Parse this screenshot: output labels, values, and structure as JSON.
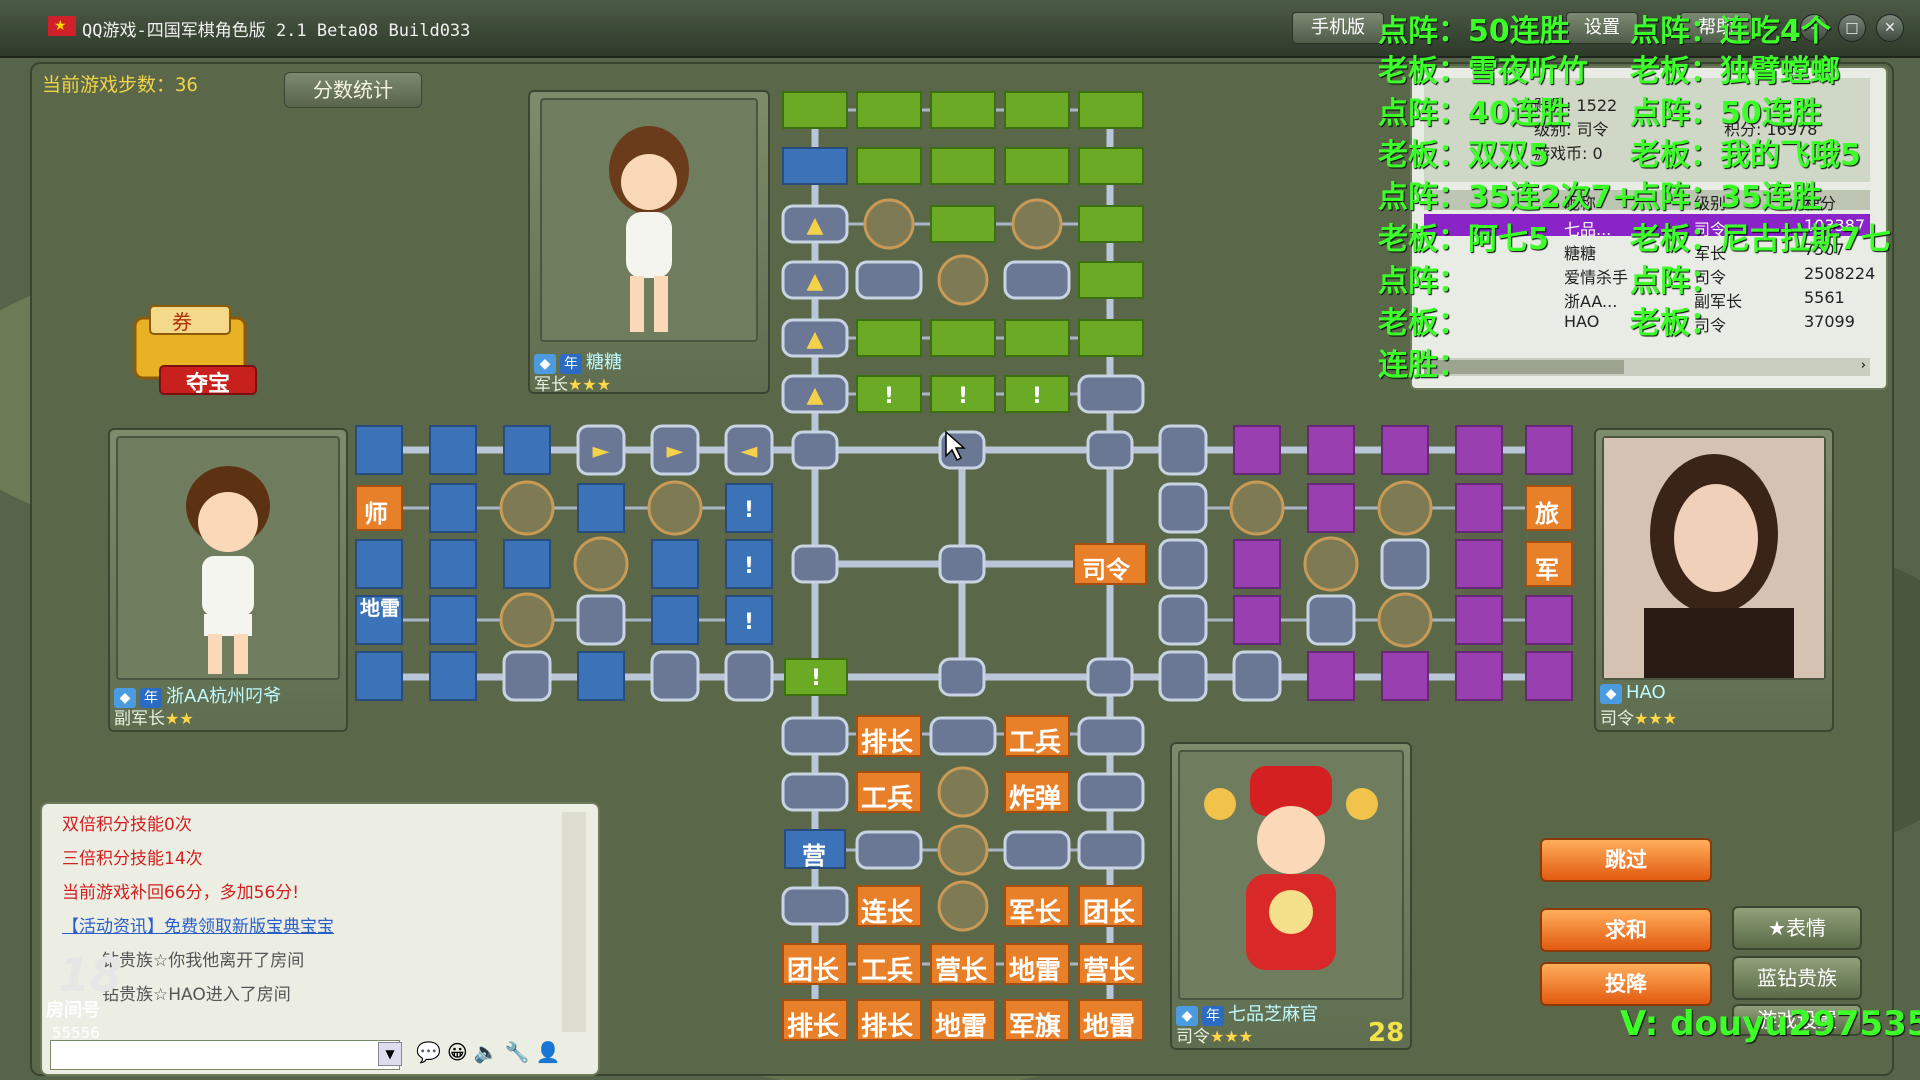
{
  "window": {
    "title": "QQ游戏-四国军棋角色版 2.1 Beta08 Build033",
    "top_buttons": [
      "手机版",
      "设置",
      "帮助"
    ]
  },
  "game": {
    "steps_label": "当前游戏步数：36",
    "score_stats": "分数统计",
    "treasure_top": "券",
    "treasure_label": "夺宝"
  },
  "players": {
    "top": {
      "name": "糖糖",
      "rank": "军长",
      "badge": "年"
    },
    "left": {
      "name": "浙AA杭州叼爷",
      "rank": "副军长",
      "badge": "年"
    },
    "right": {
      "name": "HAO",
      "rank": "司令",
      "badge": "年"
    },
    "bottom": {
      "name": "七品芝麻官",
      "rank": "司令",
      "badge": "年",
      "timer": "28"
    }
  },
  "board_labels": {
    "left_side": [
      "师",
      "地雷"
    ],
    "right_side": [
      "旅",
      "军"
    ],
    "center": "司令",
    "green_marker": "!",
    "bottom_rows": [
      [
        "排长",
        "工兵"
      ],
      [
        "工兵",
        "炸弹"
      ],
      [
        "营"
      ],
      [
        "连长",
        "军长",
        "团长"
      ],
      [
        "团长",
        "工兵",
        "营长",
        "地雷",
        "营长"
      ],
      [
        "排长",
        "排长",
        "地雷",
        "军旗",
        "地雷"
      ]
    ]
  },
  "chat": {
    "lines": [
      {
        "text": "双倍积分技能0次",
        "color": "#d22020"
      },
      {
        "text": "三倍积分技能14次",
        "color": "#d22020"
      },
      {
        "text": "当前游戏补回66分，多加56分!",
        "color": "#d22020"
      },
      {
        "text": "【活动资讯】免费领取新版宝典宝宝",
        "color": "#2a5fc8"
      },
      {
        "text": "钻贵族☆你我他离开了房间",
        "color": "#555555"
      },
      {
        "text": "钻贵族☆HAO进入了房间",
        "color": "#555555"
      }
    ],
    "room_label": "房间号",
    "room_number": "55556",
    "room_logo": "18"
  },
  "actions": {
    "skip": "跳过",
    "peace": "求和",
    "surrender": "投降",
    "emote": "表情",
    "vip": "蓝钻贵族",
    "settings": "游戏设置"
  },
  "rank_table": {
    "info": [
      "账号: 1522",
      "级别: 司令",
      "积分: 16978",
      "游戏币: 0"
    ],
    "headers": [
      "昵称",
      "级别",
      "积分"
    ],
    "rows": [
      {
        "name": "七品...",
        "rank": "司令",
        "score": "103387"
      },
      {
        "name": "糖糖",
        "rank": "军长",
        "score": "7507"
      },
      {
        "name": "爱情杀手",
        "rank": "司令",
        "score": "2508224"
      },
      {
        "name": "浙AA...",
        "rank": "副军长",
        "score": "5561"
      },
      {
        "name": "HAO",
        "rank": "司令",
        "score": "37099"
      }
    ]
  },
  "overlay": {
    "lines": [
      [
        "点阵：50连胜",
        "点阵：连吃4个"
      ],
      [
        "老板：雪夜听竹",
        "老板：独臂螳螂"
      ],
      [
        "点阵：40连胜",
        "点阵：50连胜"
      ],
      [
        "老板：双双5",
        "老板：我的飞哦5"
      ],
      [
        "点阵：35连2次7+",
        "点阵：35连胜"
      ],
      [
        "老板：阿七5",
        "老板：尼古拉斯7七"
      ],
      [
        "点阵：",
        "点阵："
      ],
      [
        "老板：",
        "老板："
      ],
      [
        "连胜：",
        ""
      ]
    ],
    "contact": "V: douyu297535"
  }
}
